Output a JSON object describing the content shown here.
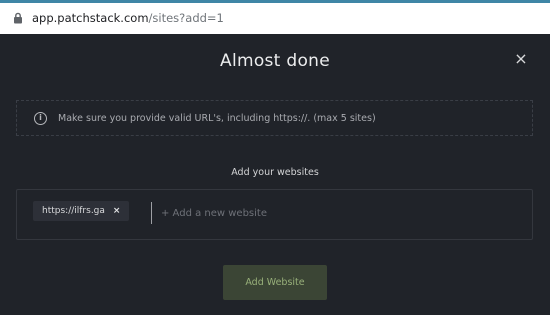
{
  "browser": {
    "url_domain": "app.patchstack.com",
    "url_path": "/sites?add=1"
  },
  "modal": {
    "title": "Almost done",
    "close_symbol": "×",
    "notice": {
      "icon": "info-icon",
      "text": "Make sure you provide valid URL's, including https://. (max 5 sites)"
    },
    "section_label": "Add your websites",
    "websites": [
      {
        "label": "https://ilfrs.ga",
        "remove_symbol": "×"
      }
    ],
    "input": {
      "value": "",
      "placeholder": "+ Add a new website"
    },
    "submit_label": "Add Website"
  }
}
